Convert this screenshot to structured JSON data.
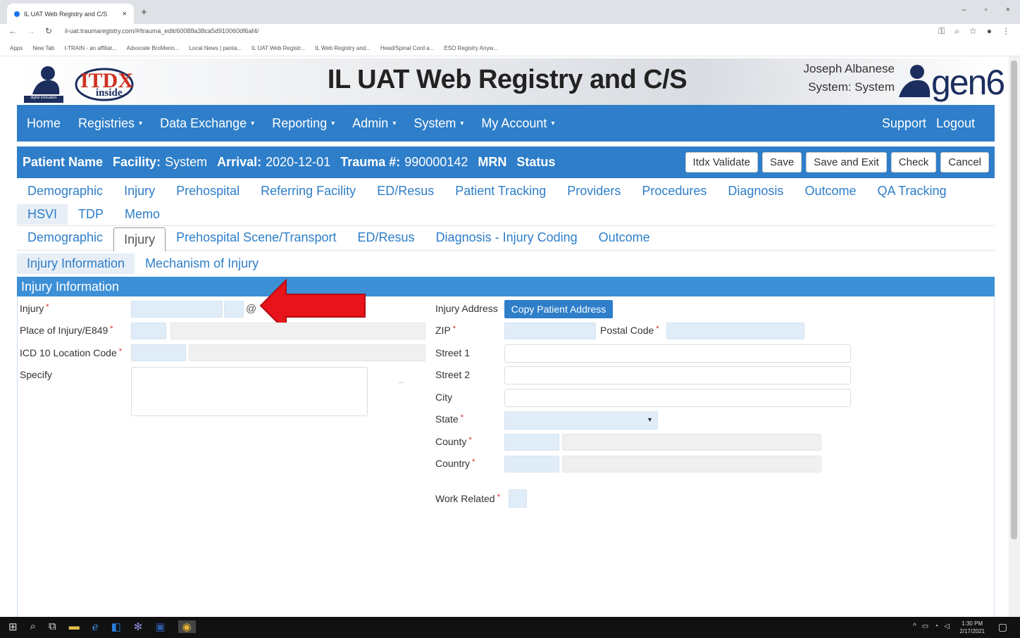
{
  "browser": {
    "tab_title": "IL UAT Web Registry and C/S",
    "tab_close": "×",
    "new_tab": "+",
    "url": "il-uat.traumaregistry.com/#/trauma_edit/60088a38ca5d910060df6af4/",
    "window_controls": [
      "–",
      "▫",
      "×"
    ],
    "bookmarks": [
      "Apps",
      "New Tab",
      "I-TRAIN - an affiliat...",
      "Advocate BroMenn...",
      "Local News | panta...",
      "IL UAT Web Registr...",
      "IL Web Registry and...",
      "Head/Spinal Cord a...",
      "ESO Registry Anyw..."
    ]
  },
  "header": {
    "app_title": "IL UAT Web Registry and C/S",
    "user_name": "Joseph Albanese",
    "system_label": "System: System",
    "logo_left_caption": "digital innovation",
    "logo_mid_text": "ITDX",
    "logo_mid_sub": "inside",
    "logo_right_text": "gen6"
  },
  "main_nav": {
    "items": [
      "Home",
      "Registries",
      "Data Exchange",
      "Reporting",
      "Admin",
      "System",
      "My Account"
    ],
    "right_items": [
      "Support",
      "Logout"
    ],
    "caret": "▾"
  },
  "patient_bar": {
    "name_label": "Patient Name",
    "facility_label": "Facility:",
    "facility_value": "System",
    "arrival_label": "Arrival:",
    "arrival_value": "2020-12-01",
    "trauma_label": "Trauma #:",
    "trauma_value": "990000142",
    "mrn_label": "MRN",
    "status_label": "Status",
    "buttons": [
      "Itdx Validate",
      "Save",
      "Save and Exit",
      "Check",
      "Cancel"
    ]
  },
  "record_tabs": {
    "row1": [
      "Demographic",
      "Injury",
      "Prehospital",
      "Referring Facility",
      "ED/Resus",
      "Patient Tracking",
      "Providers",
      "Procedures",
      "Diagnosis",
      "Outcome",
      "QA Tracking"
    ],
    "row2": [
      "HSVI",
      "TDP",
      "Memo"
    ]
  },
  "sub_tabs": [
    "Demographic",
    "Injury",
    "Prehospital Scene/Transport",
    "ED/Resus",
    "Diagnosis - Injury Coding",
    "Outcome"
  ],
  "section_tabs": [
    "Injury Information",
    "Mechanism of Injury"
  ],
  "panel": {
    "title": "Injury Information",
    "required_mark": "*",
    "left_labels": [
      "Injury",
      "Place of Injury/E849",
      "ICD 10 Location Code",
      "Specify"
    ],
    "at_sign": "@",
    "ellipsis": "...",
    "injury_address_label": "Injury Address",
    "copy_button": "Copy Patient Address",
    "zip_label": "ZIP",
    "postal_label": "Postal Code",
    "street1_label": "Street 1",
    "street2_label": "Street 2",
    "city_label": "City",
    "state_label": "State",
    "county_label": "County",
    "country_label": "Country",
    "work_related_label": "Work Related"
  },
  "taskbar": {
    "time": "1:30 PM",
    "date": "2/17/2021"
  },
  "colors": {
    "nav_blue": "#2e7ec9",
    "panel_blue": "#3d8fd6",
    "arrow_red": "#e8141c"
  }
}
